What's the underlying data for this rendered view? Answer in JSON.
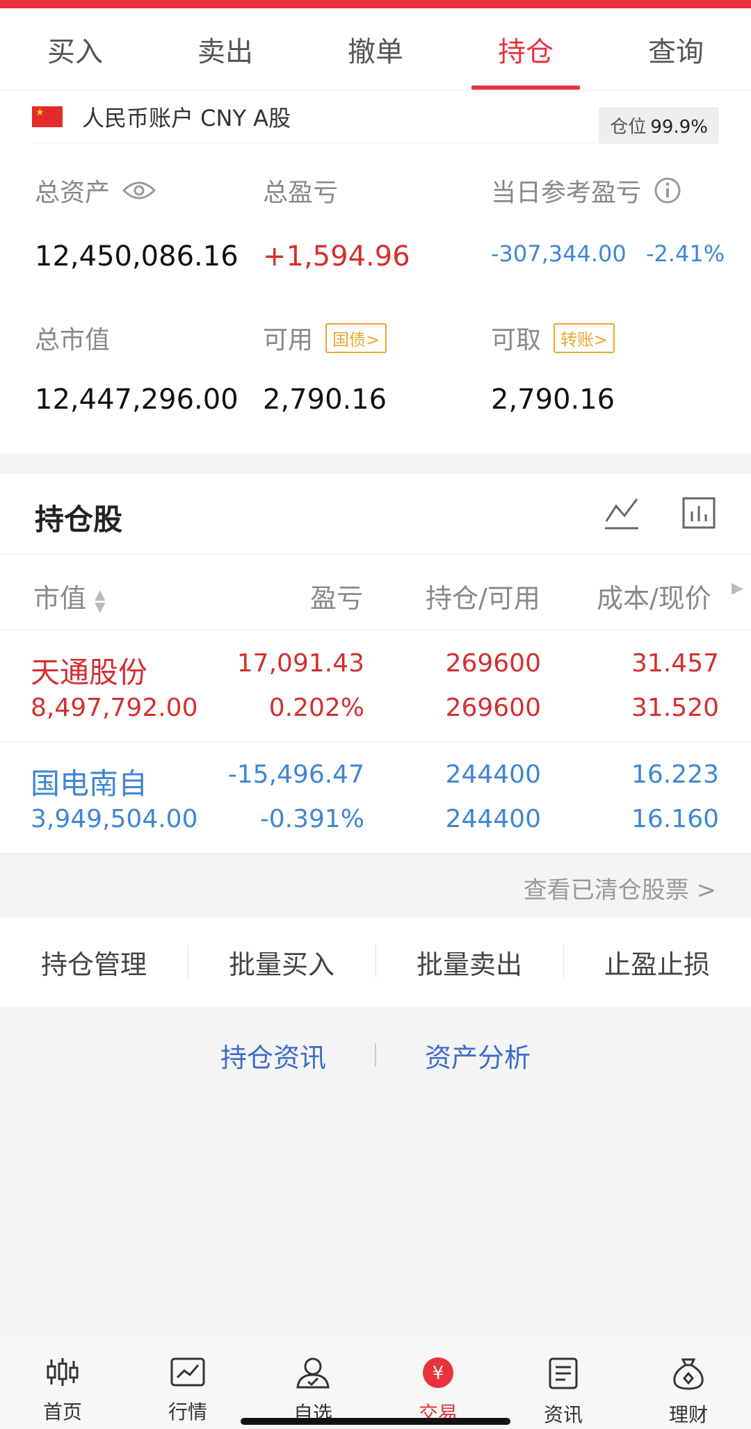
{
  "tabs": [
    {
      "label": "买入"
    },
    {
      "label": "卖出"
    },
    {
      "label": "撤单"
    },
    {
      "label": "持仓",
      "active": true
    },
    {
      "label": "查询"
    }
  ],
  "account": {
    "name": "人民币账户 CNY A股",
    "position_label": "仓位",
    "position_value": "99.9%"
  },
  "stats": {
    "total_assets_label": "总资产",
    "total_assets": "12,450,086.16",
    "total_pnl_label": "总盈亏",
    "total_pnl": "+1,594.96",
    "daily_pnl_label": "当日参考盈亏",
    "daily_pnl": "-307,344.00",
    "daily_pnl_pct": "-2.41%",
    "market_value_label": "总市值",
    "market_value": "12,447,296.00",
    "available_label": "可用",
    "available_tag": "国债>",
    "available": "2,790.16",
    "withdrawable_label": "可取",
    "withdrawable_tag": "转账>",
    "withdrawable": "2,790.16"
  },
  "holdings": {
    "title": "持仓股",
    "columns": [
      "市值",
      "盈亏",
      "持仓/可用",
      "成本/现价"
    ],
    "rows": [
      {
        "name": "天通股份",
        "market_value": "8,497,792.00",
        "pnl": "17,091.43",
        "pnl_pct": "0.202%",
        "position": "269600",
        "available": "269600",
        "cost": "31.457",
        "price": "31.520"
      },
      {
        "name": "国电南自",
        "market_value": "3,949,504.00",
        "pnl": "-15,496.47",
        "pnl_pct": "-0.391%",
        "position": "244400",
        "available": "244400",
        "cost": "16.223",
        "price": "16.160"
      }
    ],
    "cleared_link": "查看已清仓股票 >"
  },
  "actions": [
    "持仓管理",
    "批量买入",
    "批量卖出",
    "止盈止损"
  ],
  "links": [
    "持仓资讯",
    "资产分析"
  ],
  "bottom_nav": [
    {
      "label": "首页",
      "icon": "candlestick-icon"
    },
    {
      "label": "行情",
      "icon": "chart-icon"
    },
    {
      "label": "自选",
      "icon": "person-icon"
    },
    {
      "label": "交易",
      "icon": "yuan-icon",
      "active": true
    },
    {
      "label": "资讯",
      "icon": "document-icon"
    },
    {
      "label": "理财",
      "icon": "moneybag-icon"
    }
  ],
  "colors": {
    "accent": "#e8323c",
    "gain": "#d32f2f",
    "loss": "#3f86d2",
    "link": "#3d6cc8",
    "tag": "#e8a82c"
  }
}
